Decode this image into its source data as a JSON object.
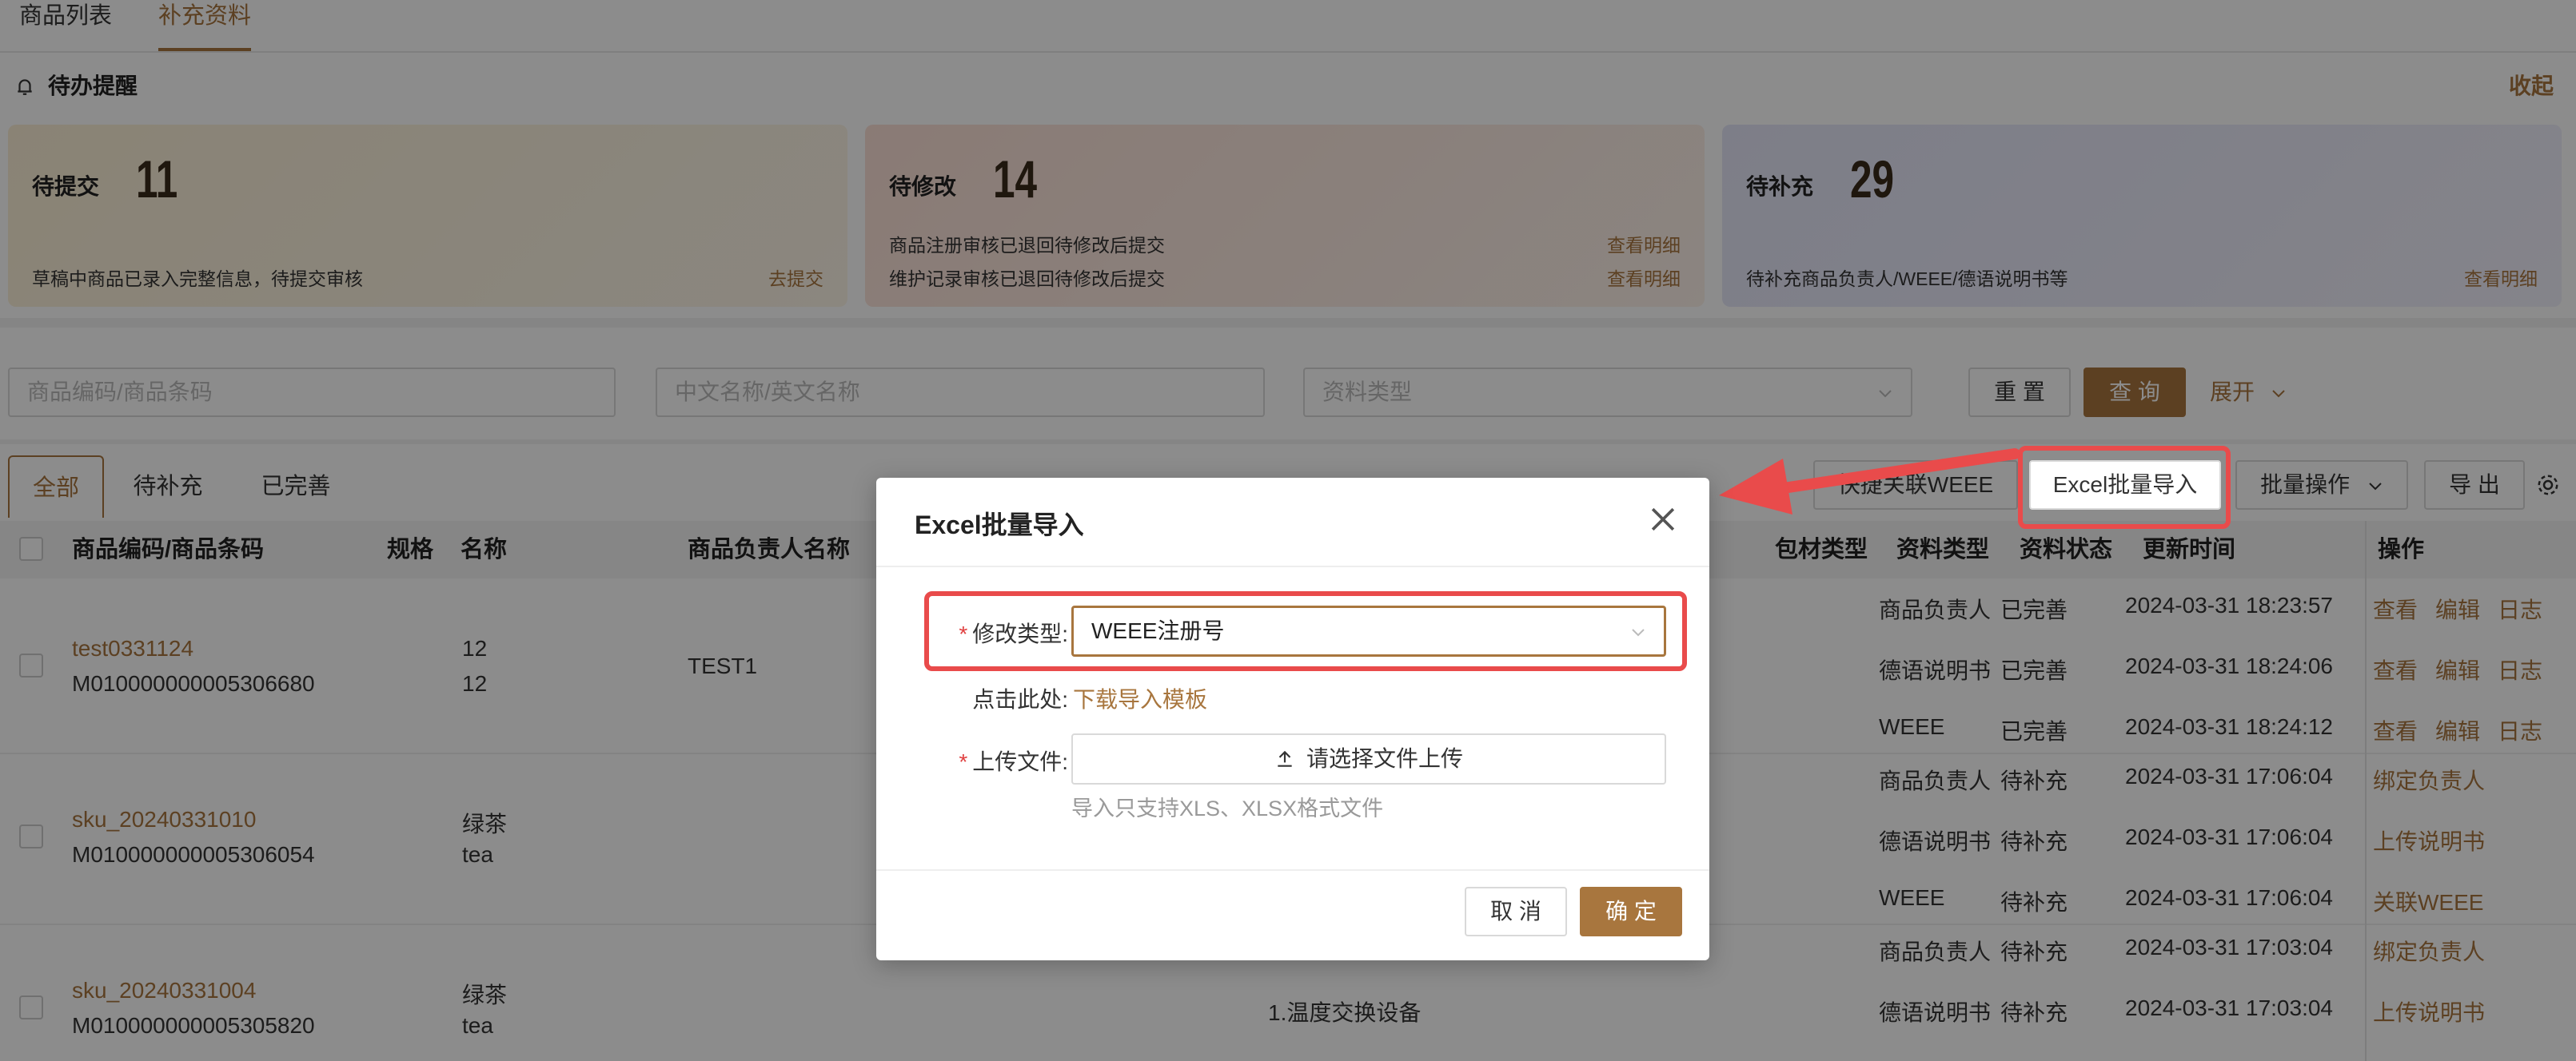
{
  "tabs": [
    "商品列表",
    "补充资料"
  ],
  "todo": {
    "title": "待办提醒",
    "collapse": "收起",
    "cards": [
      {
        "title": "待提交",
        "count": "11",
        "lines": [
          {
            "text": "草稿中商品已录入完整信息，待提交审核",
            "link": "去提交"
          }
        ]
      },
      {
        "title": "待修改",
        "count": "14",
        "lines": [
          {
            "text": "商品注册审核已退回待修改后提交",
            "link": "查看明细"
          },
          {
            "text": "维护记录审核已退回待修改后提交",
            "link": "查看明细"
          }
        ]
      },
      {
        "title": "待补充",
        "count": "29",
        "lines": [
          {
            "text": "待补充商品负责人/WEEE/德语说明书等",
            "link": "查看明细"
          }
        ]
      }
    ]
  },
  "filters": {
    "code_placeholder": "商品编码/商品条码",
    "name_placeholder": "中文名称/英文名称",
    "type_placeholder": "资料类型",
    "reset": "重 置",
    "query": "查 询",
    "expand": "展开"
  },
  "status_tabs": [
    "全部",
    "待补充",
    "已完善"
  ],
  "toolbar": {
    "quick_link": "快捷关联WEEE",
    "excel_import": "Excel批量导入",
    "batch": "批量操作",
    "export": "导 出"
  },
  "table": {
    "headers": [
      "商品编码/商品条码",
      "规格",
      "名称",
      "商品负责人名称",
      "包材类型",
      "资料类型",
      "资料状态",
      "更新时间",
      "操作"
    ],
    "rows": [
      {
        "code": "test0331124",
        "barcode": "M010000000005306680",
        "spec": "",
        "name1": "12",
        "name2": "12",
        "owner": "TEST1",
        "pack": "",
        "subs": [
          {
            "type": "商品负责人",
            "status": "已完善",
            "time": "2024-03-31 18:23:57",
            "ops": [
              "查看",
              "编辑",
              "日志"
            ]
          },
          {
            "type": "德语说明书",
            "status": "已完善",
            "time": "2024-03-31 18:24:06",
            "ops": [
              "查看",
              "编辑",
              "日志"
            ]
          },
          {
            "type": "WEEE",
            "status": "已完善",
            "time": "2024-03-31 18:24:12",
            "ops": [
              "查看",
              "编辑",
              "日志"
            ]
          }
        ]
      },
      {
        "code": "sku_20240331010",
        "barcode": "M010000000005306054",
        "spec": "",
        "name1": "绿茶",
        "name2": "tea",
        "owner": "",
        "pack": "",
        "subs": [
          {
            "type": "商品负责人",
            "status": "待补充",
            "time": "2024-03-31 17:06:04",
            "ops": [
              "绑定负责人"
            ]
          },
          {
            "type": "德语说明书",
            "status": "待补充",
            "time": "2024-03-31 17:06:04",
            "ops": [
              "上传说明书"
            ]
          },
          {
            "type": "WEEE",
            "status": "待补充",
            "time": "2024-03-31 17:06:04",
            "ops": [
              "关联WEEE"
            ]
          }
        ]
      },
      {
        "code": "sku_20240331004",
        "barcode": "M010000000005305820",
        "spec": "",
        "name1": "绿茶",
        "name2": "tea",
        "owner": "",
        "pack": "1.温度交换设备",
        "subs": [
          {
            "type": "商品负责人",
            "status": "待补充",
            "time": "2024-03-31 17:03:04",
            "ops": [
              "绑定负责人"
            ]
          },
          {
            "type": "德语说明书",
            "status": "待补充",
            "time": "2024-03-31 17:03:04",
            "ops": [
              "上传说明书"
            ]
          }
        ]
      }
    ]
  },
  "modal": {
    "title": "Excel批量导入",
    "type_label": "修改类型:",
    "type_value": "WEEE注册号",
    "download_label": "点击此处:",
    "download_link": "下载导入模板",
    "upload_label": "上传文件:",
    "upload_button": "请选择文件上传",
    "upload_hint": "导入只支持XLS、XLSX格式文件",
    "cancel": "取 消",
    "confirm": "确 定"
  },
  "colors": {
    "accent": "#a8763e",
    "highlight": "#e94b4b"
  }
}
